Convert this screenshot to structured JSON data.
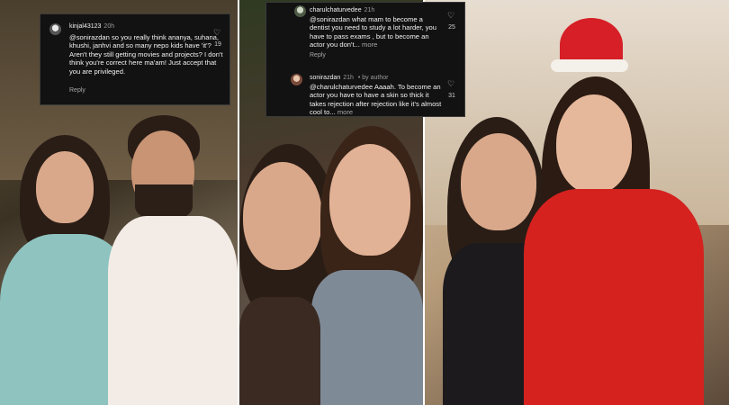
{
  "comments_left": [
    {
      "username": "kinjal43123",
      "time": "20h",
      "text": "@sonirazdan so you really think ananya, suhana, khushi, janhvi and so many nepo kids have 'it'? Aren't they still getting movies and projects? I don't think you're correct here ma'am! Just accept that you are privileged.",
      "reply_label": "Reply",
      "likes": "19",
      "icon": "heart-icon"
    }
  ],
  "comments_right": [
    {
      "username": "charulchaturvedee",
      "time": "21h",
      "text": "@sonirazdan what mam to become a dentist you need to study a lot harder, you have to pass exams , but to become an actor you don't...",
      "more_label": "more",
      "reply_label": "Reply",
      "likes": "25",
      "icon": "heart-icon"
    },
    {
      "username": "sonirazdan",
      "time": "21h",
      "author_tag": "by author",
      "text": "@charulchaturvedee Aaaah. To become an actor you have to have a skin so thick it takes rejection after rejection like it's almost cool to...",
      "more_label": "more",
      "likes": "31",
      "icon": "heart-icon"
    }
  ],
  "colors": {
    "comment_bg": "#121212",
    "text": "#f2f2f2",
    "muted": "#9a9a9a"
  }
}
